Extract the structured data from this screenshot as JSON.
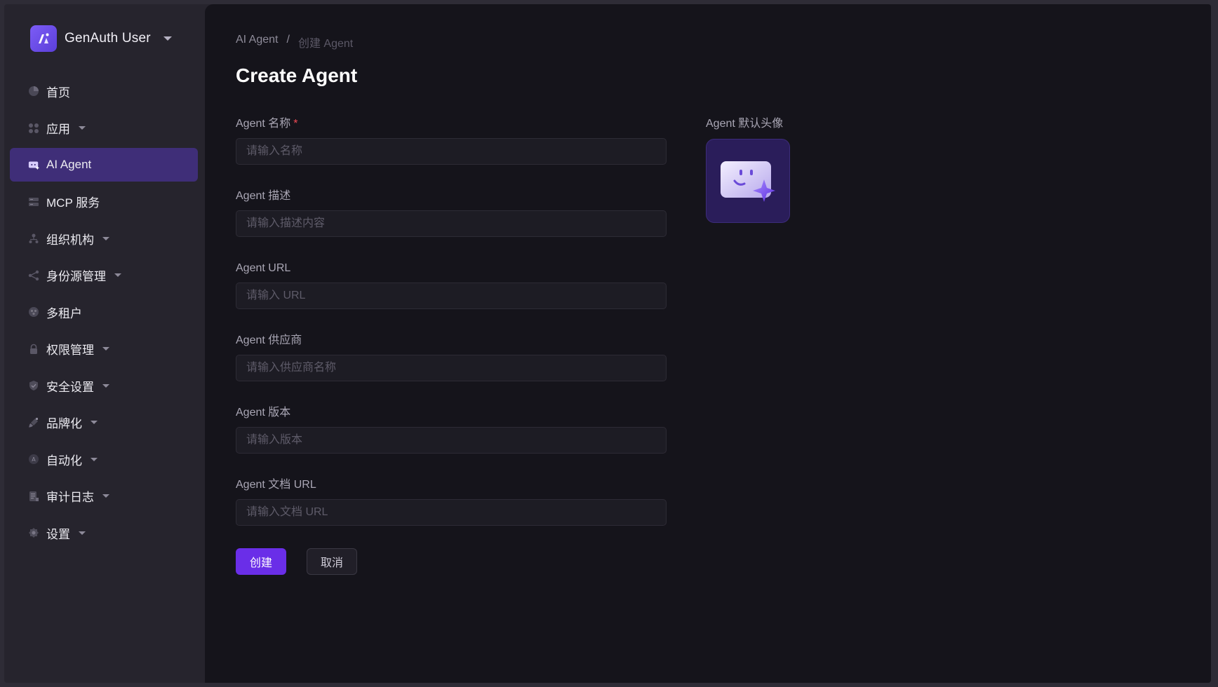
{
  "brand": {
    "name": "GenAuth User",
    "logo_icon": "genauth-logo-icon",
    "accent": "#6a2ee8"
  },
  "sidebar": {
    "items": [
      {
        "label": "首页",
        "icon": "pie-chart-icon",
        "has_caret": false,
        "active": false
      },
      {
        "label": "应用",
        "icon": "apps-grid-icon",
        "has_caret": true,
        "active": false
      },
      {
        "label": "AI Agent",
        "icon": "ai-agent-icon",
        "has_caret": false,
        "active": true
      },
      {
        "label": "MCP 服务",
        "icon": "server-icon",
        "has_caret": false,
        "active": false
      },
      {
        "label": "组织机构",
        "icon": "org-tree-icon",
        "has_caret": true,
        "active": false
      },
      {
        "label": "身份源管理",
        "icon": "share-icon",
        "has_caret": true,
        "active": false
      },
      {
        "label": "多租户",
        "icon": "tenants-icon",
        "has_caret": false,
        "active": false
      },
      {
        "label": "权限管理",
        "icon": "lock-icon",
        "has_caret": true,
        "active": false
      },
      {
        "label": "安全设置",
        "icon": "shield-check-icon",
        "has_caret": true,
        "active": false
      },
      {
        "label": "品牌化",
        "icon": "brush-icon",
        "has_caret": true,
        "active": false
      },
      {
        "label": "自动化",
        "icon": "automation-icon",
        "has_caret": true,
        "active": false
      },
      {
        "label": "审计日志",
        "icon": "audit-log-icon",
        "has_caret": true,
        "active": false
      },
      {
        "label": "设置",
        "icon": "gear-icon",
        "has_caret": true,
        "active": false
      }
    ]
  },
  "breadcrumb": {
    "parent": "AI Agent",
    "separator": "/",
    "current": "创建 Agent"
  },
  "page": {
    "title": "Create Agent"
  },
  "form": {
    "name": {
      "label": "Agent 名称",
      "required_mark": "*",
      "placeholder": "请输入名称",
      "value": ""
    },
    "description": {
      "label": "Agent 描述",
      "placeholder": "请输入描述内容",
      "value": ""
    },
    "url": {
      "label": "Agent URL",
      "placeholder": "请输入 URL",
      "value": ""
    },
    "provider": {
      "label": "Agent 供应商",
      "placeholder": "请输入供应商名称",
      "value": ""
    },
    "version": {
      "label": "Agent 版本",
      "placeholder": "请输入版本",
      "value": ""
    },
    "doc_url": {
      "label": "Agent 文档 URL",
      "placeholder": "请输入文档 URL",
      "value": ""
    }
  },
  "avatar": {
    "label": "Agent 默认头像",
    "icon": "agent-avatar-icon"
  },
  "actions": {
    "create_label": "创建",
    "cancel_label": "取消"
  }
}
